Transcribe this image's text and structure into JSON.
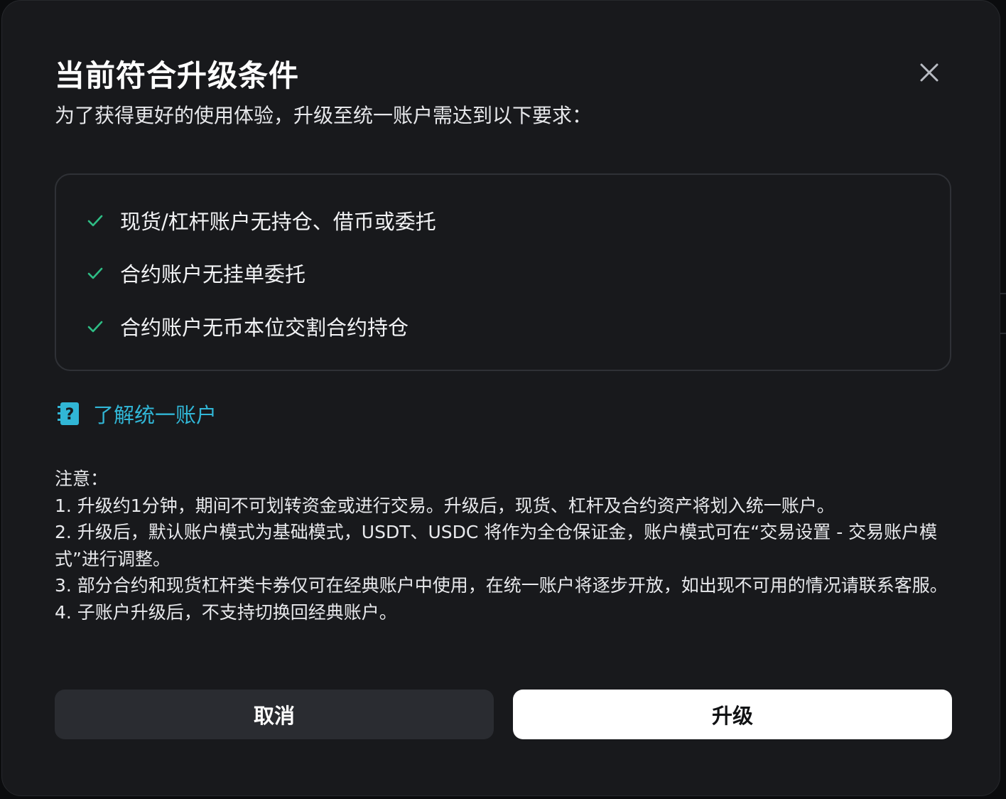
{
  "dialog": {
    "title": "当前符合升级条件",
    "subtitle": "为了获得更好的使用体验，升级至统一账户需达到以下要求：",
    "requirements": [
      "现货/杠杆账户无持仓、借币或委托",
      "合约账户无挂单委托",
      "合约账户无币本位交割合约持仓"
    ],
    "learn_link": "了解统一账户",
    "notes_title": "注意：",
    "notes": [
      "1. 升级约1分钟，期间不可划转资金或进行交易。升级后，现货、杠杆及合约资产将划入统一账户。",
      "2. 升级后，默认账户模式为基础模式，USDT、USDC 将作为全仓保证金，账户模式可在“交易设置 - 交易账户模式”进行调整。",
      "3. 部分合约和现货杠杆类卡券仅可在经典账户中使用，在统一账户将逐步开放，如出现不可用的情况请联系客服。",
      "4. 子账户升级后，不支持切换回经典账户。"
    ],
    "cancel_label": "取消",
    "upgrade_label": "升级"
  },
  "icons": {
    "close": "close-icon",
    "check": "check-icon",
    "help": "question-book-icon"
  },
  "colors": {
    "dialog_bg": "#18191c",
    "check_green": "#2ebd85",
    "link_cyan": "#31b6d6",
    "cancel_bg": "#2a2c31",
    "upgrade_bg": "#ffffff"
  }
}
